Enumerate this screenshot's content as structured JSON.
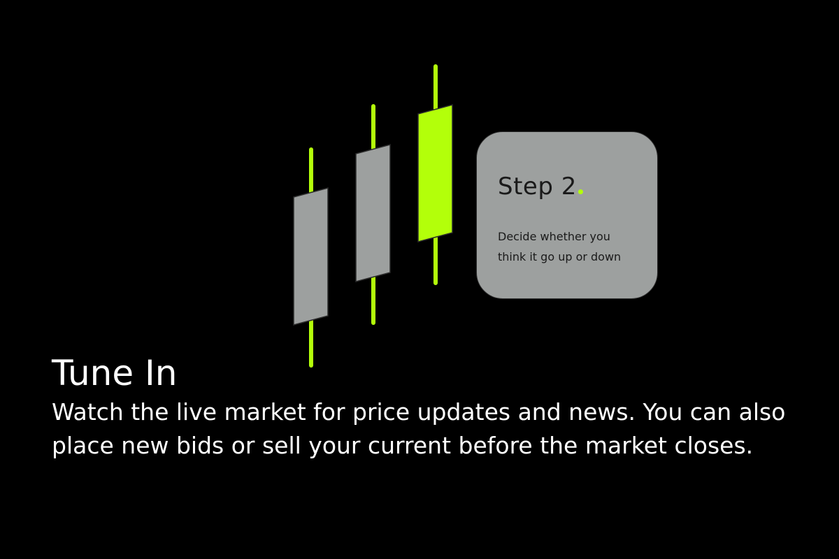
{
  "colors": {
    "background": "#000000",
    "accent_green": "#b3ff0a",
    "candle_grey": "#9da09f",
    "card_grey": "#9da09f",
    "text_dark": "#1a1a1a",
    "text_light": "#ffffff"
  },
  "candles": [
    {
      "fill": "grey",
      "wick_color": "green"
    },
    {
      "fill": "grey",
      "wick_color": "green"
    },
    {
      "fill": "green",
      "wick_color": "green"
    }
  ],
  "step_card": {
    "title": "Step 2",
    "description": "Decide whether you think it go up or down"
  },
  "headline": "Tune In",
  "body": "Watch the live market for price updates and news. You can also place new bids or sell your current before the market closes."
}
